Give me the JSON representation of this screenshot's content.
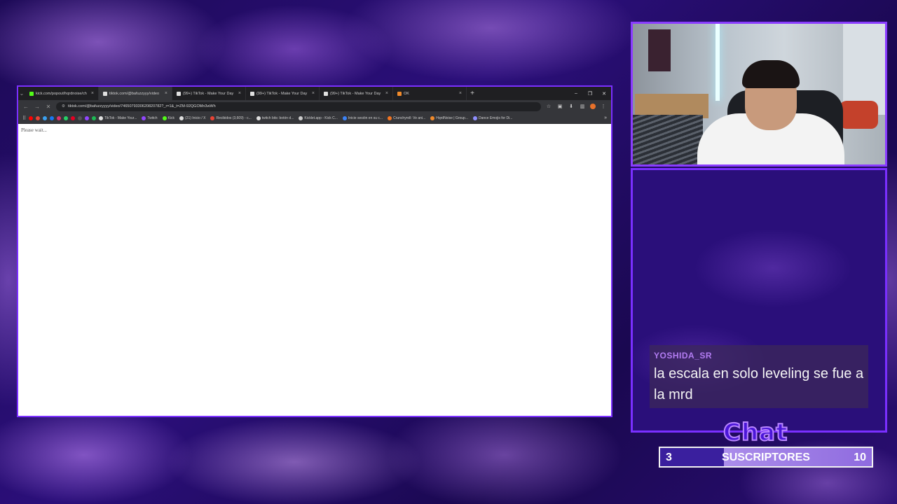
{
  "browser": {
    "tabs": [
      {
        "label": "kick.com/popout/hqrdnoise/ch",
        "icon_color": "#53fc18",
        "active": false
      },
      {
        "label": "tiktok.com/@bafuzzyyy/video",
        "icon_color": "#e0e0e0",
        "active": true
      },
      {
        "label": "(99+) TikTok - Make Your Day",
        "icon_color": "#e0e0e0",
        "active": false
      },
      {
        "label": "(99+) TikTok - Make Your Day",
        "icon_color": "#e0e0e0",
        "active": false
      },
      {
        "label": "(99+) TikTok - Make Your Day",
        "icon_color": "#e0e0e0",
        "active": false
      },
      {
        "label": "OK",
        "icon_color": "#f28b2b",
        "active": false
      }
    ],
    "url": "tiktok.com/@bafuzzyyyy/video/7465079330620820782?_r=1&_t=ZM-92QGOMn3wWh",
    "bookmarks": [
      {
        "label": "TikTok - Make Your...",
        "icon_color": "#e0e0e0"
      },
      {
        "label": "Twitch",
        "icon_color": "#9146ff"
      },
      {
        "label": "Kick",
        "icon_color": "#53fc18"
      },
      {
        "label": "(21) Inicio / X",
        "icon_color": "#e0e0e0"
      },
      {
        "label": "Recibidos (3,609) - c...",
        "icon_color": "#ea4335"
      },
      {
        "label": "twitch bits: botón d...",
        "icon_color": "#e0e0e0"
      },
      {
        "label": "Kicklet.app - Kick C...",
        "icon_color": "#cccccc"
      },
      {
        "label": "Inicie sesión en su c...",
        "icon_color": "#3b82f6"
      },
      {
        "label": "Crunchyroll: Ve ani...",
        "icon_color": "#f47521"
      },
      {
        "label": "HqrdNoise | Group...",
        "icon_color": "#f28b2b"
      },
      {
        "label": "Dance Emojis for Di...",
        "icon_color": "#8f8fff"
      }
    ],
    "page_text": "Please wait..."
  },
  "chat": {
    "username": "YOSHIDA_SR",
    "message": "la escala en solo leveling se fue a la mrd",
    "title": "Chat"
  },
  "subgoal": {
    "current": "3",
    "label": "SUSCRIPTORES",
    "target": "10",
    "progress_fraction": 0.3
  },
  "colors": {
    "accent": "#7b2fff",
    "username": "#b27cf2"
  }
}
